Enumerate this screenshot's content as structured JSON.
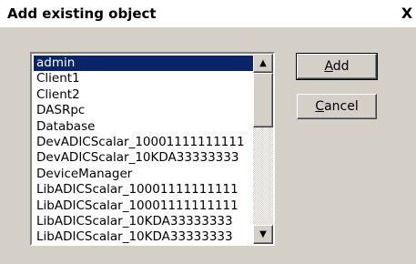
{
  "window": {
    "title": "Add existing object",
    "close_glyph": "X"
  },
  "list": {
    "selected_index": 0,
    "items": [
      "admin",
      "Client1",
      "Client2",
      "DASRpc",
      "Database",
      "DevADICScalar_10001111111111",
      "DevADICScalar_10KDA33333333",
      "DeviceManager",
      "LibADICScalar_10001111111111",
      "LibADICScalar_10001111111111",
      "LibADICScalar_10KDA33333333",
      "LibADICScalar_10KDA33333333"
    ],
    "scroll_up_glyph": "▲",
    "scroll_down_glyph": "▼"
  },
  "buttons": {
    "add": {
      "accel": "A",
      "rest": "dd"
    },
    "cancel": {
      "accel": "C",
      "rest": "ancel"
    }
  }
}
